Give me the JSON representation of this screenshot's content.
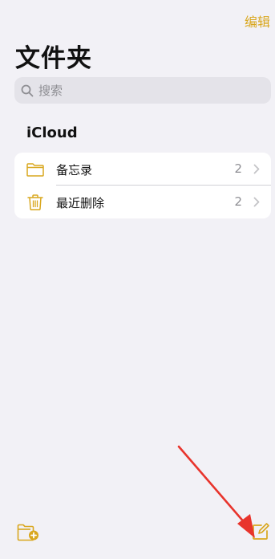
{
  "header": {
    "edit_label": "编辑",
    "title": "文件夹"
  },
  "search": {
    "placeholder": "搜索"
  },
  "section": {
    "title": "iCloud"
  },
  "folders": [
    {
      "label": "备忘录",
      "count": "2",
      "icon": "folder-icon"
    },
    {
      "label": "最近删除",
      "count": "2",
      "icon": "trash-icon"
    }
  ],
  "toolbar": {
    "new_folder_icon": "folder-plus-icon",
    "compose_icon": "compose-icon"
  },
  "colors": {
    "accent": "#D9A71E",
    "background": "#F2F1F6",
    "annotation_arrow": "#E8342C"
  }
}
